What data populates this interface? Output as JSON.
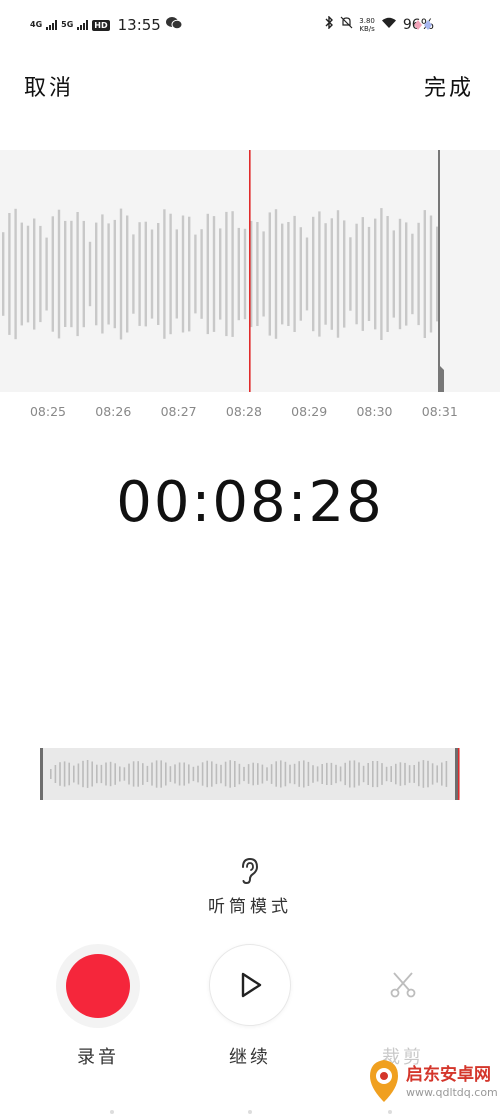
{
  "status_bar": {
    "net1": "4G",
    "net2": "5G",
    "hd": "HD",
    "time": "13:55",
    "speed_value": "3.80",
    "speed_unit": "KB/s",
    "battery": "96%"
  },
  "header": {
    "cancel_label": "取消",
    "done_label": "完成"
  },
  "waveform": {
    "ticks": [
      "08:25",
      "08:26",
      "08:27",
      "08:28",
      "08:29",
      "08:30",
      "08:31"
    ],
    "playhead_color": "#e02b2b"
  },
  "timer": "00:08:28",
  "earpiece": {
    "label": "听筒模式"
  },
  "controls": {
    "record_label": "录音",
    "continue_label": "继续",
    "trim_label": "裁剪"
  },
  "colors": {
    "record": "#f5263b",
    "wave": "#c8c8c8",
    "playhead": "#e02b2b"
  },
  "watermark": {
    "text": "启东安卓网",
    "url": "www.qdltdq.com"
  }
}
